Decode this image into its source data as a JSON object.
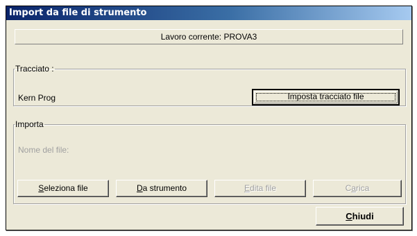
{
  "window": {
    "title": "Import da file di strumento"
  },
  "current_job": {
    "label": "Lavoro corrente: PROVA3"
  },
  "tracciato": {
    "legend": "Tracciato :",
    "format_name": "Kern Prog",
    "set_button": "Imposta tracciato file"
  },
  "importa": {
    "legend": "Importa",
    "file_name_label": "Nome del file:",
    "buttons": {
      "select_file": {
        "accel": "S",
        "rest": "eleziona file",
        "enabled": true
      },
      "from_instrument": {
        "accel": "D",
        "rest": "a strumento",
        "enabled": true
      },
      "edit_file": {
        "accel": "E",
        "rest": "dita file",
        "enabled": false
      },
      "load": {
        "pre": "C",
        "accel": "a",
        "rest": "rica",
        "enabled": false
      }
    }
  },
  "footer": {
    "close": {
      "accel": "C",
      "rest": "hiudi"
    }
  }
}
